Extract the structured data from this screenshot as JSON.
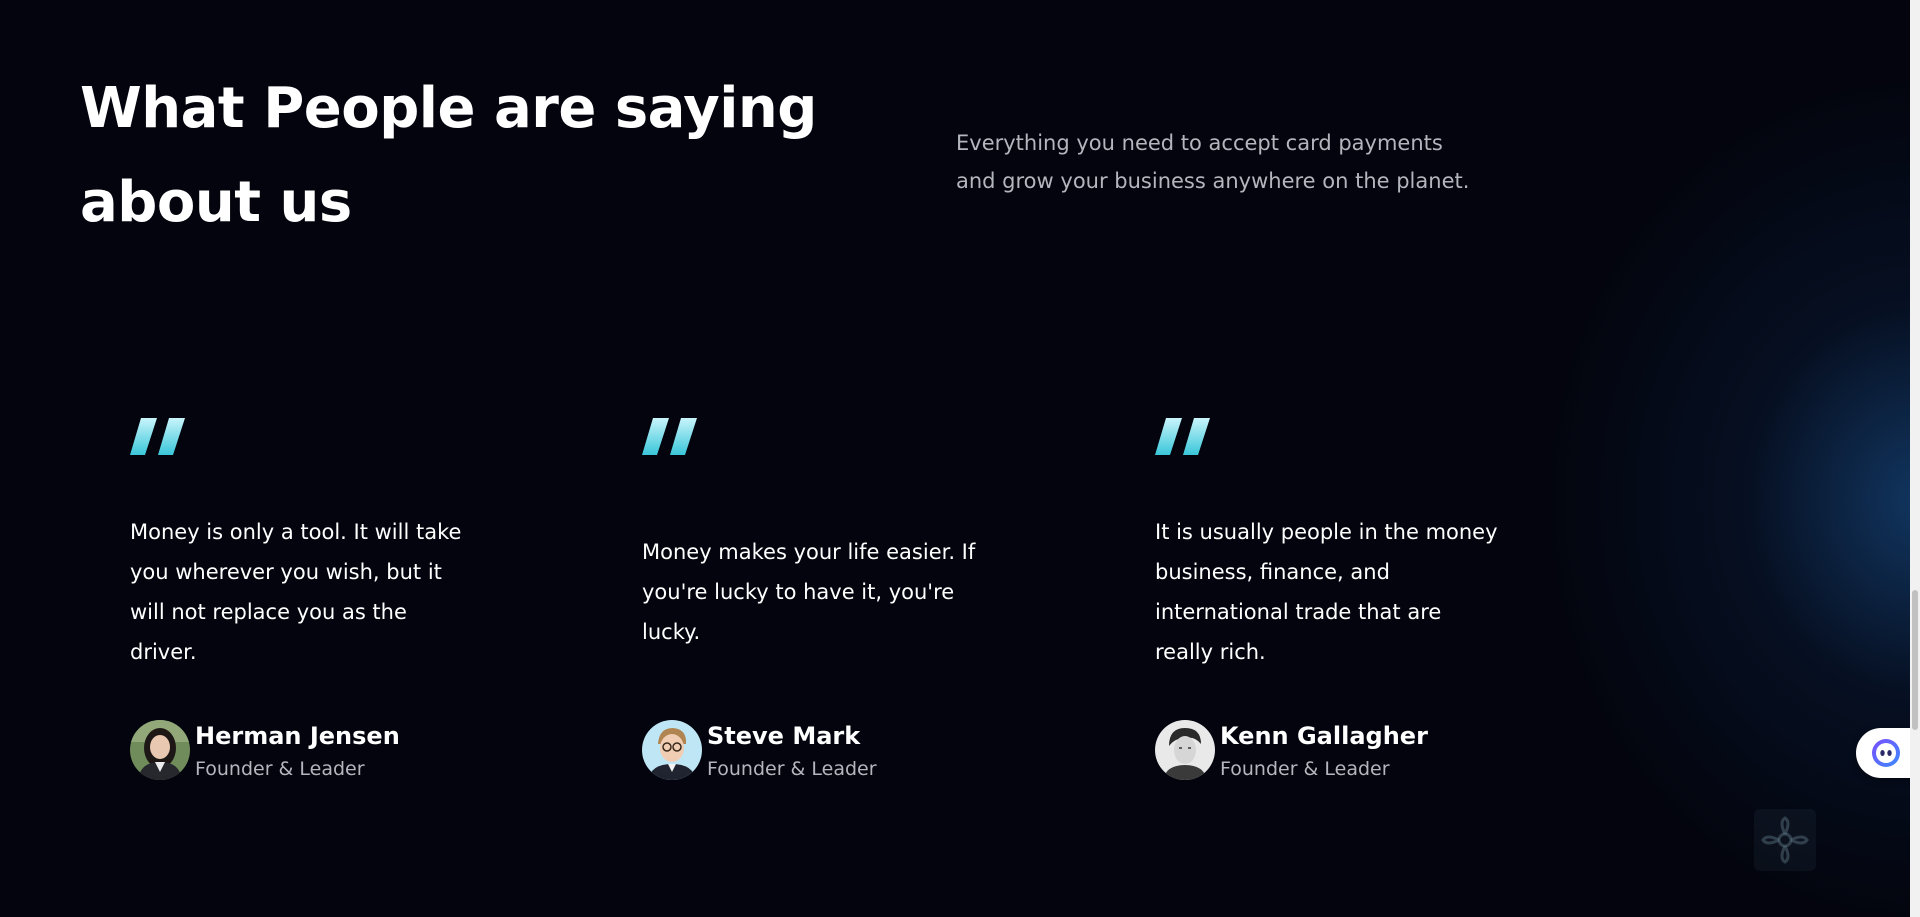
{
  "section": {
    "title_lines": [
      "What People are saying",
      "about us"
    ],
    "intro_lines": [
      "Everything you need to accept card payments",
      "and grow your business anywhere on the planet."
    ]
  },
  "testimonials": [
    {
      "quote_lines": [
        "Money is only a tool. It will take",
        "you wherever you wish, but it",
        "will not replace you as the",
        "driver."
      ],
      "name": "Herman Jensen",
      "role": "Founder & Leader"
    },
    {
      "quote_lines": [
        "Money makes your life easier. If",
        "you're lucky to have it, you're",
        "lucky."
      ],
      "name": "Steve Mark",
      "role": "Founder & Leader"
    },
    {
      "quote_lines": [
        "It is usually people in the money",
        "business, finance, and",
        "international trade that are",
        "really rich."
      ],
      "name": "Kenn Gallagher",
      "role": "Founder & Leader"
    }
  ],
  "icons": {
    "quote": "quote-icon",
    "chat": "chat-assistant-icon",
    "watermark": "flower-logo-icon"
  },
  "colors": {
    "background": "#03040d",
    "accent_gradient_start": "#39c6d9",
    "accent_gradient_end": "#c9f5fb",
    "text_primary": "#ffffff",
    "text_muted": "#b4b6be"
  }
}
